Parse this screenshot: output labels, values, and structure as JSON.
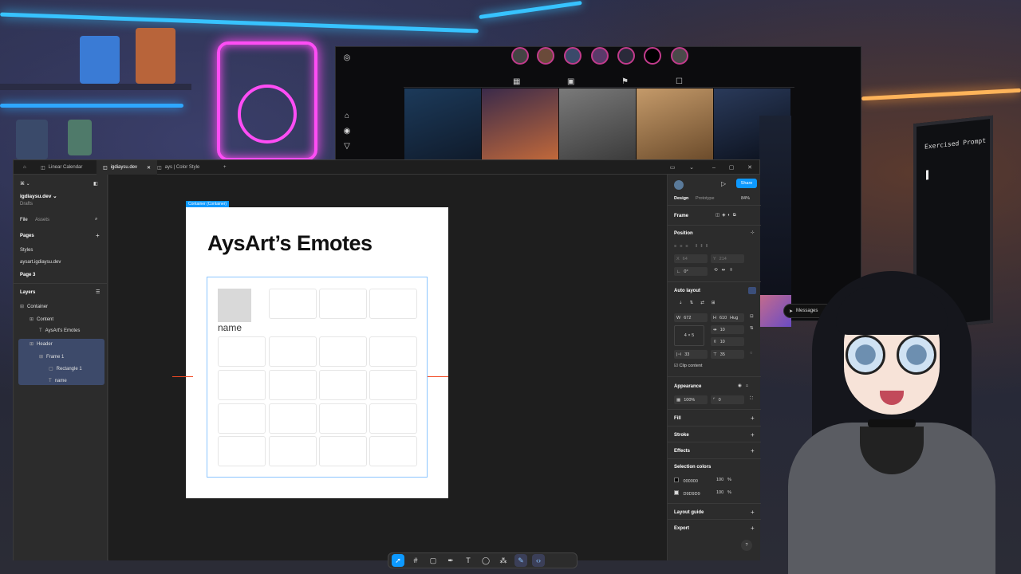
{
  "figma": {
    "tabs": [
      {
        "label": "Linear Calendar"
      },
      {
        "label": "igdiaysu.dev"
      },
      {
        "label": "ays | Color Style"
      }
    ],
    "file": {
      "name": "igdiaysu.dev",
      "location": "Drafts"
    },
    "panel_tabs": {
      "file": "File",
      "assets": "Assets"
    },
    "pages": {
      "heading": "Pages",
      "items": [
        {
          "label": "Styles"
        },
        {
          "label": "aysart.igdiaysu.dev"
        },
        {
          "label": "Page 3"
        }
      ]
    },
    "layers": {
      "heading": "Layers",
      "items": [
        {
          "label": "Container"
        },
        {
          "label": "Content"
        },
        {
          "label": "AysArt's Emotes"
        },
        {
          "label": "Header"
        },
        {
          "label": "Frame 1"
        },
        {
          "label": "Rectangle 1"
        },
        {
          "label": "name"
        }
      ]
    },
    "canvas": {
      "frame_tag": "Container (Container)",
      "title": "AysArt’s Emotes",
      "cell_label": "name"
    },
    "right_panel": {
      "tabs": {
        "design": "Design",
        "prototype": "Prototype"
      },
      "share": "Share",
      "zoom": "84%",
      "frame_label": "Frame",
      "position": {
        "heading": "Position",
        "x": "64",
        "y": "214",
        "rotation": "0°"
      },
      "auto_layout": {
        "heading": "Auto layout",
        "w": "672",
        "h": "610",
        "h_mode": "Hug",
        "gap_h": "10",
        "gap_v": "10",
        "grid": "4 × 5",
        "pad_h": "33",
        "pad_v": "35",
        "clip": "Clip content"
      },
      "appearance": {
        "heading": "Appearance",
        "opacity": "100%",
        "radius": "0"
      },
      "fill": "Fill",
      "stroke": "Stroke",
      "effects": "Effects",
      "selection_colors": {
        "heading": "Selection colors",
        "items": [
          {
            "hex": "000000",
            "opacity": "100",
            "pct": "%",
            "color": "#000000"
          },
          {
            "hex": "D9D9D9",
            "opacity": "100",
            "pct": "%",
            "color": "#D9D9D9"
          }
        ]
      },
      "layout_guide": "Layout guide",
      "export": "Export",
      "help": "?"
    }
  },
  "background": {
    "monitor_text": "Exercised Prompt",
    "messages": "Messages"
  },
  "colors": {
    "accent": "#0d99ff",
    "selection": "#3d4a6a",
    "neon_pink": "#ff4df5",
    "neon_blue": "#37c3ff"
  }
}
